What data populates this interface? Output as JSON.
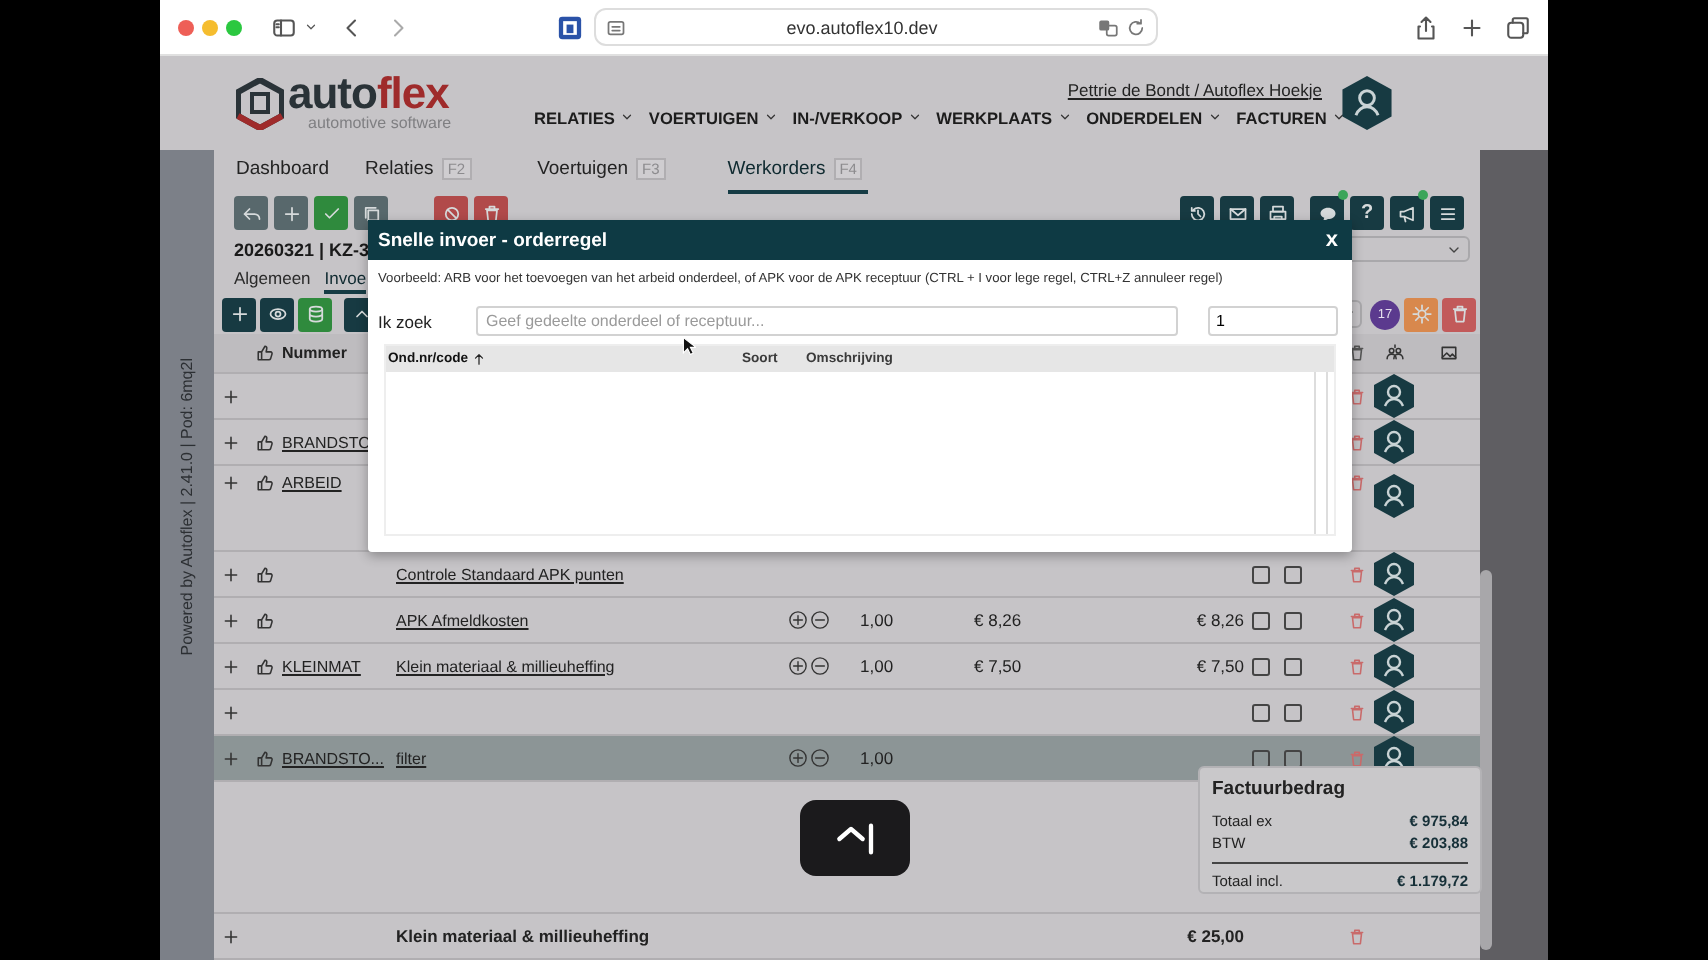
{
  "browser": {
    "url": "evo.autoflex10.dev"
  },
  "header": {
    "logo": {
      "parts": [
        "auto",
        "flex"
      ],
      "tagline": "automotive software"
    },
    "user": "Pettrie de Bondt / Autoflex Hoekje",
    "menu": [
      "RELATIES",
      "VOERTUIGEN",
      "IN-/VERKOOP",
      "WERKPLAATS",
      "ONDERDELEN",
      "FACTUREN"
    ]
  },
  "side_label": "Powered by Autoflex | 2.41.0 | Pod: 6mq2l",
  "tabs": [
    {
      "label": "Dashboard",
      "selected": false
    },
    {
      "label": "Relaties",
      "shortcut": "F2",
      "selected": false
    },
    {
      "label": "Voertuigen",
      "shortcut": "F3",
      "selected": false
    },
    {
      "label": "Werkorders",
      "shortcut": "F4",
      "selected": true
    }
  ],
  "toolbar": {
    "help_label": "?"
  },
  "order_title": "20260321 | KZ-3",
  "subtabs": [
    {
      "label": "Algemeen",
      "selected": false
    },
    {
      "label": "Invoe",
      "selected": true
    }
  ],
  "badge": "17",
  "table": {
    "columns": [
      "Nummer"
    ],
    "rows": [
      {
        "thumb": false,
        "selected": false
      },
      {
        "thumb": true,
        "number": "BRANDSTO",
        "selected": false
      },
      {
        "thumb": true,
        "number": "ARBEID",
        "tall": true,
        "selected": false
      },
      {
        "thumb": true,
        "description": "Controle Standaard APK punten",
        "flags": [
          {
            "checked": false
          },
          {
            "checked": false
          }
        ],
        "selected": false
      },
      {
        "thumb": true,
        "description": "APK Afmeldkosten",
        "stepper": true,
        "quantity": "1,00",
        "price": "€ 8,26",
        "total": "€ 8,26",
        "flags": [
          {
            "checked": false
          },
          {
            "checked": false
          }
        ],
        "selected": false
      },
      {
        "thumb": true,
        "number": "KLEINMAT",
        "description": "Klein materiaal & millieuheffing",
        "stepper": true,
        "quantity": "1,00",
        "price": "€ 7,50",
        "total": "€ 7,50",
        "flags": [
          {
            "checked": false
          },
          {
            "checked": false
          }
        ],
        "selected": false
      },
      {
        "thumb": false,
        "flags": [
          {
            "checked": false
          },
          {
            "checked": false
          }
        ],
        "selected": false
      },
      {
        "thumb": true,
        "number": "BRANDSTO...",
        "description": "filter",
        "stepper": true,
        "quantity": "1,00",
        "flags": [
          {
            "checked": false
          },
          {
            "checked": false
          }
        ],
        "selected": true
      }
    ]
  },
  "totals_row": {
    "description": "Klein materiaal & millieuheffing",
    "total": "€ 25,00"
  },
  "invoice": {
    "title": "Factuurbedrag",
    "lines": [
      {
        "label": "Totaal ex",
        "value": "€ 975,84"
      },
      {
        "label": "BTW",
        "value": "€ 203,88"
      },
      {
        "label": "Totaal incl.",
        "value": "€ 1.179,72"
      }
    ]
  },
  "modal": {
    "title": "Snelle invoer - orderregel",
    "close": "x",
    "hint": "Voorbeeld: ARB voor het toevoegen van het arbeid onderdeel, of APK voor de APK receptuur (CTRL + I voor lege regel, CTRL+Z annuleer regel)",
    "search_label": "Ik zoek",
    "placeholder": "Geef gedeelte onderdeel of receptuur...",
    "quantity": "1",
    "columns": [
      {
        "label": "Ond.nr/code",
        "sorted": true
      },
      {
        "label": "Soort",
        "sorted": false
      },
      {
        "label": "Omschrijving",
        "sorted": false
      }
    ]
  }
}
